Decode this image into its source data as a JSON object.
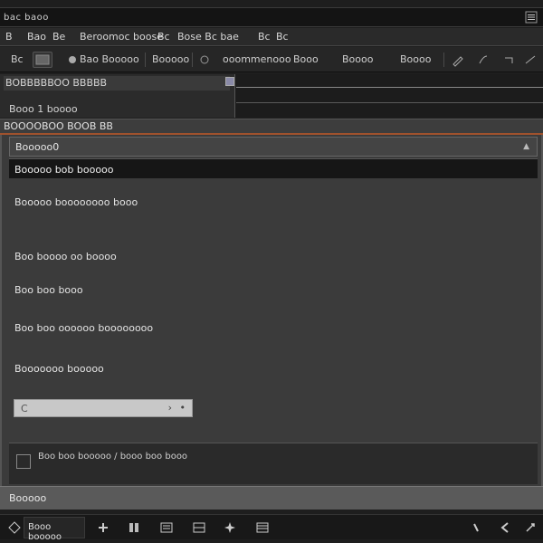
{
  "window": {
    "title": "bac baoo"
  },
  "menubar": {
    "items": [
      "B",
      "Bao",
      "Be",
      "Beroomoc boose",
      "Bc",
      "Bose Bc bae",
      "Bc",
      "Bc"
    ]
  },
  "toolbar": {
    "field_label": "Bc",
    "btn_primary": "Bao Booooo",
    "btn_secondary": "Booooo",
    "btn_tertiary": "ooommenooo",
    "btn_quat": "Booo",
    "btn_five": "Boooo",
    "btn_six": "Boooo"
  },
  "top_panel": {
    "header": "BOBBBBBOO BBBBB",
    "subtitle": "Booo 1 boooo"
  },
  "section_bar": {
    "label": "BOOOOBOO BOOB BB"
  },
  "main": {
    "dropdown_header": "Booooo0",
    "selected_row": "Booooo bob booooo",
    "items": [
      "Booooo boooooooo booo",
      "Boo boooo oo boooo",
      "Boo boo booo",
      "Boo boo oooooo boooooooo",
      "Booooooo booooo"
    ],
    "select": {
      "value": "C"
    }
  },
  "options": {
    "label": "Boo boo booooo / booo boo booo"
  },
  "status": {
    "text": "Booooo"
  },
  "bottombar": {
    "tab_label": "Booo booooo"
  },
  "colors": {
    "accent": "#a0522d",
    "panel": "#3b3b3b",
    "bar": "#181818"
  },
  "icons": [
    "menu-icon",
    "app-icon",
    "refresh-icon",
    "plus-icon",
    "columns-icon",
    "list-icon",
    "grid-icon",
    "star-icon",
    "table-icon",
    "pointer-icon",
    "back-icon"
  ]
}
